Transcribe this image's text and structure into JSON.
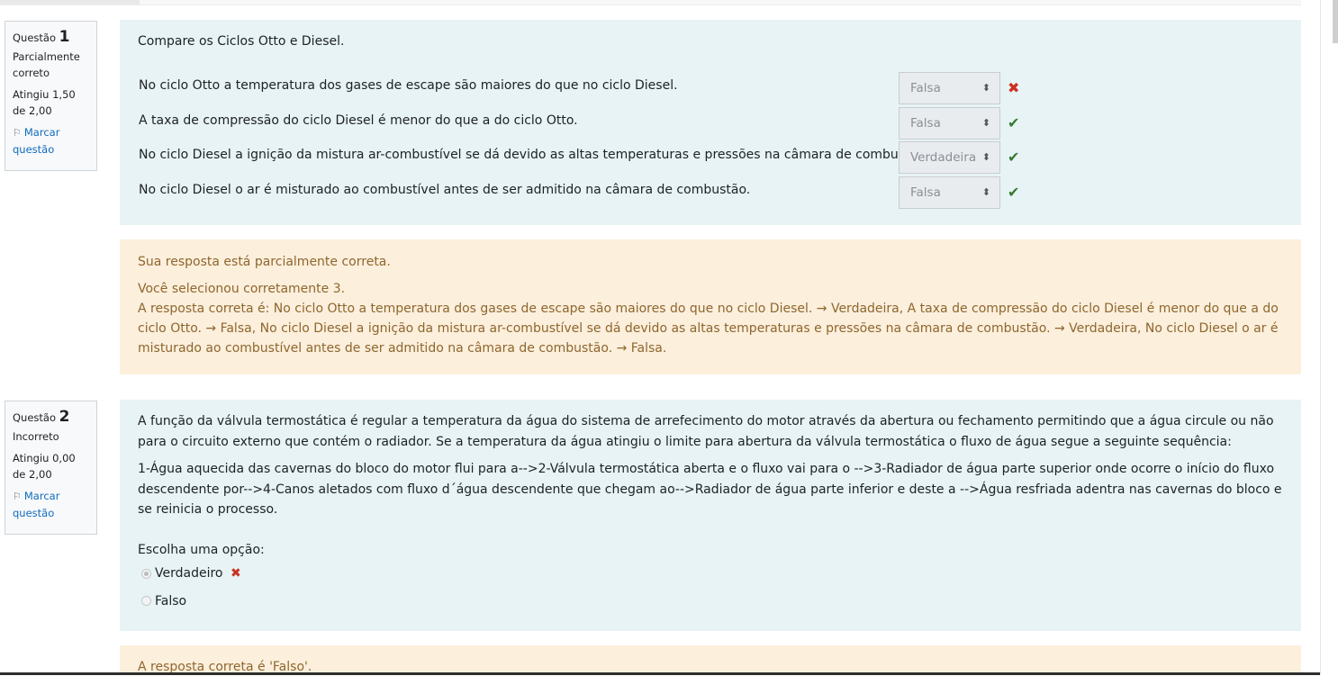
{
  "q1": {
    "info": {
      "label": "Questão",
      "number": "1",
      "state": "Parcialmente correto",
      "grade": "Atingiu 1,50 de 2,00",
      "flag": "Marcar questão"
    },
    "prompt": "Compare os Ciclos Otto e Diesel.",
    "rows": [
      {
        "stem": "No ciclo Otto a temperatura dos gases de escape são maiores do que no ciclo Diesel.",
        "selected": "Falsa",
        "result": "incorrect"
      },
      {
        "stem": "A taxa de compressão do ciclo Diesel é menor do que a do ciclo Otto.",
        "selected": "Falsa",
        "result": "correct"
      },
      {
        "stem": "No ciclo Diesel a ignição da mistura ar-combustível se dá devido as altas temperaturas e pressões na câmara de combustão.",
        "selected": "Verdadeira",
        "result": "correct"
      },
      {
        "stem": "No ciclo Diesel o ar é misturado ao combustível antes de ser admitido na câmara de combustão.",
        "selected": "Falsa",
        "result": "correct"
      }
    ],
    "feedback": {
      "status": "Sua resposta está parcialmente correta.",
      "count": "Você selecionou corretamente 3.",
      "right_answer": "A resposta correta é: No ciclo Otto a temperatura dos gases de escape são maiores do que no ciclo Diesel. → Verdadeira, A taxa de compressão do ciclo Diesel é menor do que a do ciclo Otto. → Falsa, No ciclo Diesel a ignição da mistura ar-combustível se dá devido as altas temperaturas e pressões na câmara de combustão. → Verdadeira, No ciclo Diesel o ar é misturado ao combustível antes de ser admitido na câmara de combustão. → Falsa."
    }
  },
  "q2": {
    "info": {
      "label": "Questão",
      "number": "2",
      "state": "Incorreto",
      "grade": "Atingiu 0,00 de 2,00",
      "flag": "Marcar questão"
    },
    "paragraph1": "A função da válvula termostática é regular a temperatura da água do sistema de arrefecimento do motor através da abertura ou fechamento permitindo que a água circule ou não para o circuito externo que contém o radiador. Se a temperatura da água atingiu o limite para abertura da válvula termostática o fluxo de água segue a seguinte sequência:",
    "paragraph2": "1-Água aquecida das cavernas do bloco do motor flui para a-->2-Válvula termostática aberta e o fluxo vai para o -->3-Radiador de água parte superior onde ocorre o início do fluxo descendente por-->4-Canos aletados com fluxo d´água descendente que chegam ao-->Radiador de água parte inferior e deste a -->Água resfriada adentra nas cavernas do bloco e se reinicia o processo.",
    "choose_label": "Escolha uma opção:",
    "options": [
      {
        "label": "Verdadeiro",
        "checked": true,
        "result": "incorrect"
      },
      {
        "label": "Falso",
        "checked": false
      }
    ],
    "feedback": {
      "right_answer": "A resposta correta é 'Falso'."
    }
  },
  "colors": {
    "correct": "#357a32",
    "incorrect": "#ca3120",
    "link": "#0f6cbf",
    "formulation_bg": "#e7f3f5",
    "feedback_bg": "#fcefdc"
  }
}
